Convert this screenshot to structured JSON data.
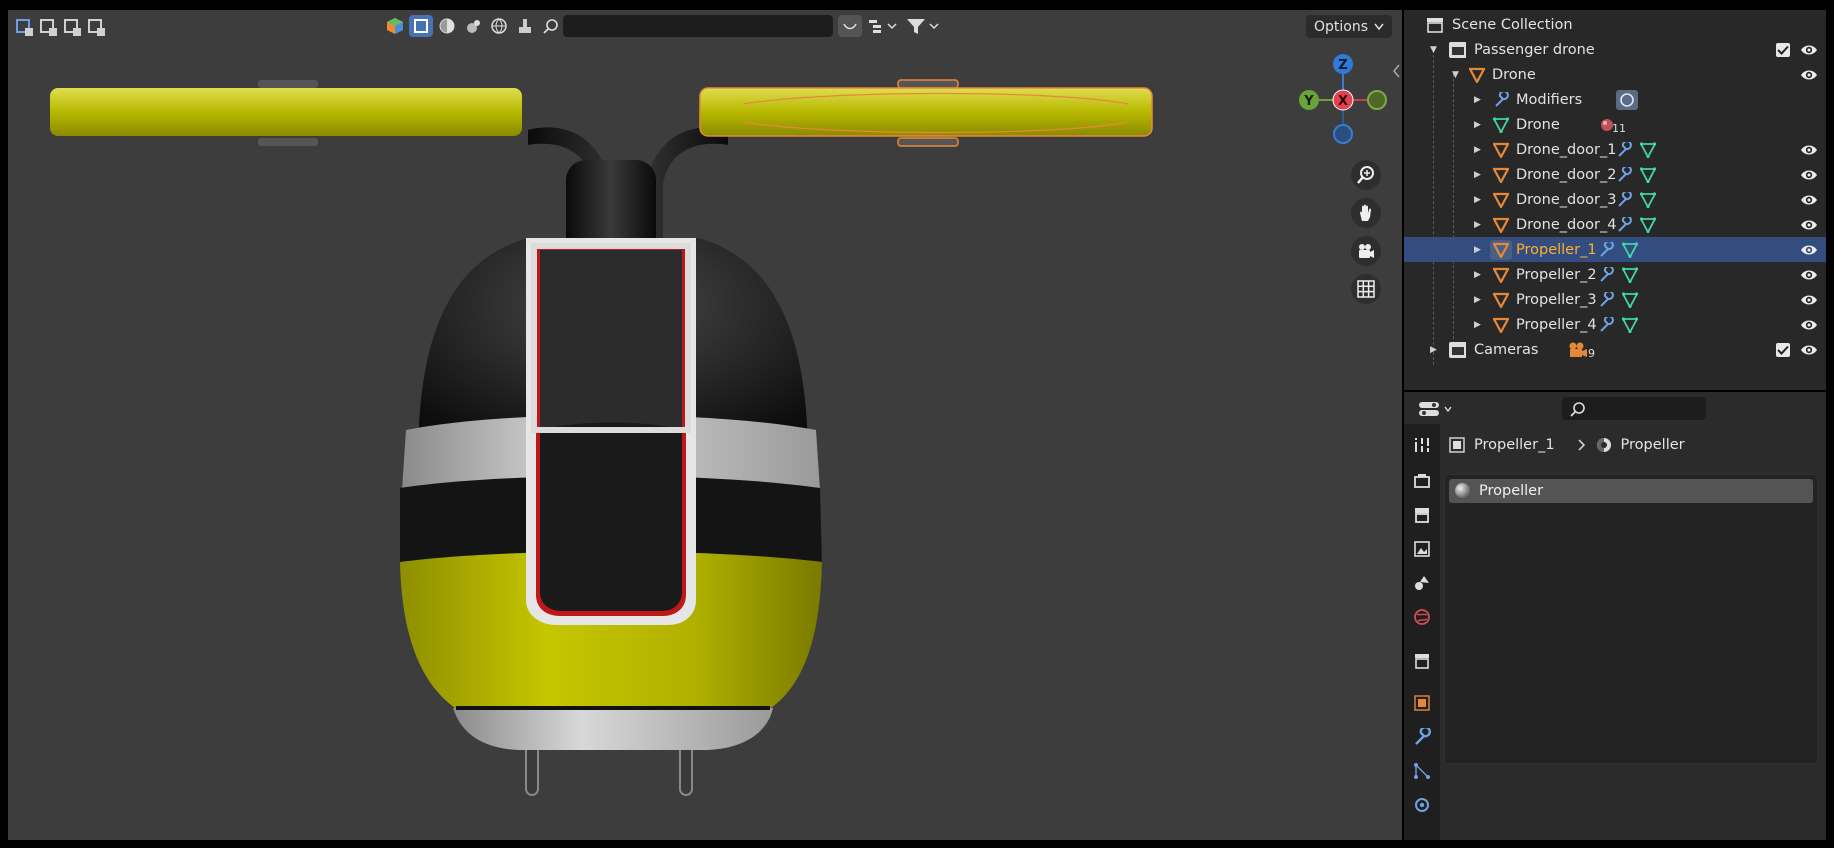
{
  "viewport": {
    "search_placeholder": "",
    "options_label": "Options",
    "gizmo": {
      "z": "Z",
      "y": "Y",
      "x": "X"
    }
  },
  "outliner": {
    "scene_collection": "Scene Collection",
    "rows": [
      {
        "label": "Passenger drone",
        "type": "collection"
      },
      {
        "label": "Drone",
        "type": "object"
      },
      {
        "label": "Modifiers",
        "type": "modifiers"
      },
      {
        "label": "Drone",
        "type": "mesh",
        "badge": "11"
      },
      {
        "label": "Drone_door_1",
        "type": "object"
      },
      {
        "label": "Drone_door_2",
        "type": "object"
      },
      {
        "label": "Drone_door_3",
        "type": "object"
      },
      {
        "label": "Drone_door_4",
        "type": "object"
      },
      {
        "label": "Propeller_1",
        "type": "object",
        "selected": true
      },
      {
        "label": "Propeller_2",
        "type": "object"
      },
      {
        "label": "Propeller_3",
        "type": "object"
      },
      {
        "label": "Propeller_4",
        "type": "object"
      },
      {
        "label": "Cameras",
        "type": "collection",
        "badge": "9"
      }
    ]
  },
  "properties": {
    "breadcrumb_object": "Propeller_1",
    "breadcrumb_material": "Propeller",
    "material_slot": "Propeller"
  },
  "colors": {
    "selection": "#334d80",
    "active_text": "#ffaf29",
    "object_icon": "#e6883a",
    "mesh_icon": "#3fd6a8",
    "modifier_icon": "#6ea2e6",
    "body_yellow": "#b8b800"
  }
}
